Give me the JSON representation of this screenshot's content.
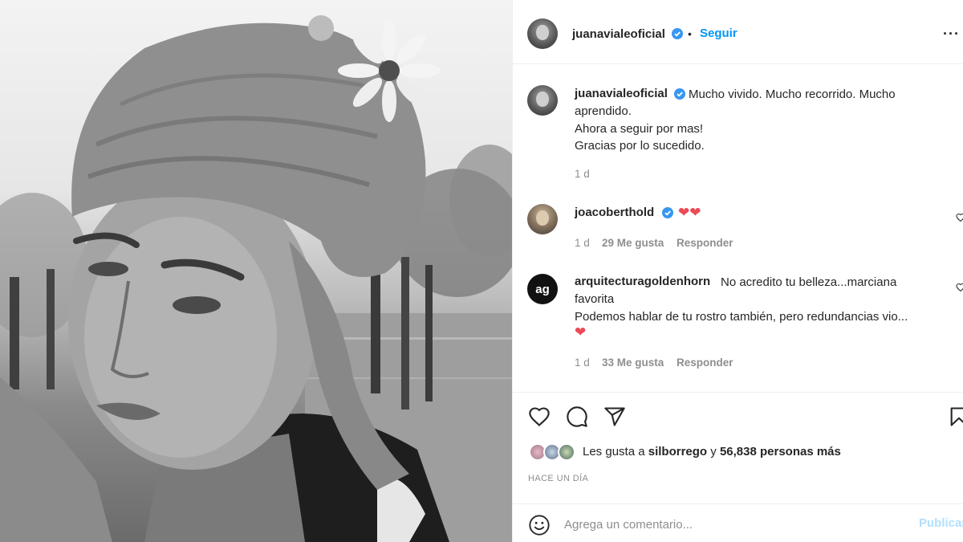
{
  "post": {
    "author": "juanavialeoficial",
    "follow_label": "Seguir",
    "separator": "•",
    "more_label": "···"
  },
  "caption": {
    "author": "juanavialeoficial",
    "line1": "Mucho vivido. Mucho recorrido. Mucho",
    "line2": "aprendido.",
    "line3": "Ahora a seguir por mas!",
    "line4": "Gracias por lo sucedido.",
    "time": "1 d"
  },
  "comments": [
    {
      "author": "joacoberthold",
      "text": "❤❤",
      "time": "1 d",
      "likes": "29 Me gusta",
      "reply": "Responder"
    },
    {
      "author": "arquitecturagoldenhorn",
      "avatar_text": "ag",
      "text_line1": "No acredito tu belleza...marciana",
      "text_line2": "favorita",
      "text_line3": "Podemos hablar de tu rostro también, pero redundancias vio...",
      "text_line4": "❤",
      "time": "1 d",
      "likes": "33 Me gusta",
      "reply": "Responder"
    }
  ],
  "likes": {
    "prefix": "Les gusta a",
    "user": "silborrego",
    "conj": "y",
    "count": "56,838 personas más"
  },
  "timestamp": "HACE UN DÍA",
  "comment_box": {
    "placeholder": "Agrega un comentario...",
    "publish_label": "Publicar"
  },
  "colors": {
    "link_blue": "#0095f6",
    "heart_red": "#ed4956",
    "verified_blue": "#3897f0",
    "muted": "#8e8e8e"
  },
  "icons": [
    "heart-icon",
    "comment-icon",
    "share-icon",
    "save-icon",
    "emoji-icon",
    "verified-icon",
    "more-icon"
  ]
}
